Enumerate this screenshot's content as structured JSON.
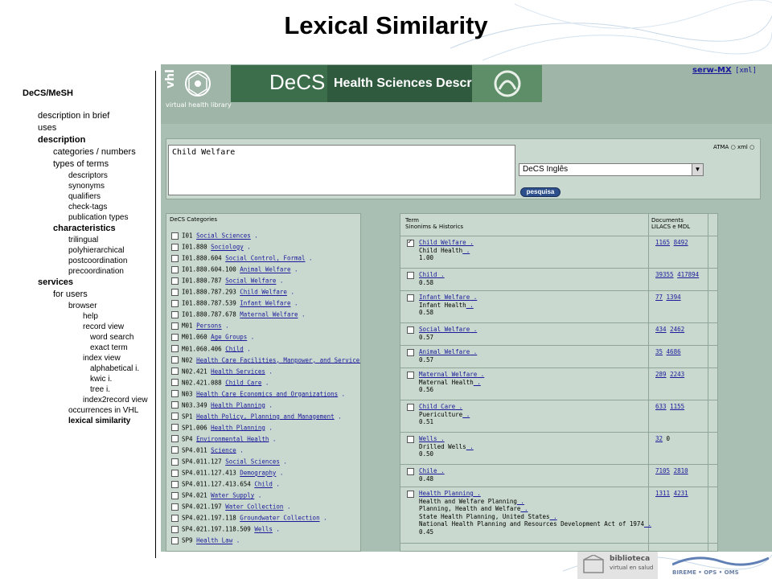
{
  "slide": {
    "title": "Lexical Similarity"
  },
  "outline": [
    {
      "text": "DeCS/MeSH",
      "level": 0,
      "bold": true
    },
    {
      "text": "description in brief",
      "level": 1,
      "bold": false
    },
    {
      "text": "uses",
      "level": 1,
      "bold": false
    },
    {
      "text": "description",
      "level": 1,
      "bold": true
    },
    {
      "text": "categories / numbers",
      "level": 2,
      "bold": false
    },
    {
      "text": "types of terms",
      "level": 2,
      "bold": false
    },
    {
      "text": "descriptors",
      "level": 3,
      "bold": false
    },
    {
      "text": "synonyms",
      "level": 3,
      "bold": false
    },
    {
      "text": "qualifiers",
      "level": 3,
      "bold": false
    },
    {
      "text": "check-tags",
      "level": 3,
      "bold": false
    },
    {
      "text": "publication types",
      "level": 3,
      "bold": false
    },
    {
      "text": "characteristics",
      "level": 2,
      "bold": true
    },
    {
      "text": "trilingual",
      "level": 3,
      "bold": false
    },
    {
      "text": "polyhierarchical",
      "level": 3,
      "bold": false
    },
    {
      "text": "postcoordination",
      "level": 3,
      "bold": false
    },
    {
      "text": "precoordination",
      "level": 3,
      "bold": false
    },
    {
      "text": "services",
      "level": 1,
      "bold": true
    },
    {
      "text": "for users",
      "level": 2,
      "bold": false
    },
    {
      "text": "browser",
      "level": 3,
      "bold": false
    },
    {
      "text": "help",
      "level": 4,
      "bold": false
    },
    {
      "text": "record view",
      "level": 4,
      "bold": false
    },
    {
      "text": "word search",
      "level": 5,
      "bold": false
    },
    {
      "text": "exact term",
      "level": 5,
      "bold": false
    },
    {
      "text": "index view",
      "level": 4,
      "bold": false
    },
    {
      "text": "alphabetical i.",
      "level": 5,
      "bold": false
    },
    {
      "text": "kwic i.",
      "level": 5,
      "bold": false
    },
    {
      "text": "tree i.",
      "level": 5,
      "bold": false
    },
    {
      "text": "index2record view",
      "level": 4,
      "bold": false
    },
    {
      "text": "occurrences in VHL",
      "level": 3,
      "bold": false
    },
    {
      "text": "lexical similarity",
      "level": 3,
      "bold": true
    }
  ],
  "header": {
    "vhl_text": "virtual health library",
    "decs_word": "DeCS",
    "decs_sub": "Health Sciences Descriptors",
    "serw_link": "serw-MX",
    "xml_link": "[xml]"
  },
  "search": {
    "query": "Child Welfare",
    "language": "DeCS Inglês",
    "button": "pesquisa",
    "atma": "ATMA",
    "xml": "xml"
  },
  "categories": {
    "title": "DeCS Categories",
    "rows": [
      {
        "code": "I01",
        "name": "Social Sciences"
      },
      {
        "code": "I01.880",
        "name": "Sociology"
      },
      {
        "code": "I01.880.604",
        "name": "Social Control, Formal"
      },
      {
        "code": "I01.880.604.100",
        "name": "Animal Welfare"
      },
      {
        "code": "I01.880.787",
        "name": "Social Welfare"
      },
      {
        "code": "I01.880.787.293",
        "name": "Child Welfare"
      },
      {
        "code": "I01.880.787.539",
        "name": "Infant Welfare"
      },
      {
        "code": "I01.880.787.678",
        "name": "Maternal Welfare"
      },
      {
        "code": "M01",
        "name": "Persons"
      },
      {
        "code": "M01.060",
        "name": "Age Groups"
      },
      {
        "code": "M01.060.406",
        "name": "Child"
      },
      {
        "code": "N02",
        "name": "Health Care Facilities, Manpower, and Services"
      },
      {
        "code": "N02.421",
        "name": "Health Services"
      },
      {
        "code": "N02.421.088",
        "name": "Child Care"
      },
      {
        "code": "N03",
        "name": "Health Care Economics and Organizations"
      },
      {
        "code": "N03.349",
        "name": "Health Planning"
      },
      {
        "code": "SP1",
        "name": "Health Policy, Planning and Management"
      },
      {
        "code": "SP1.006",
        "name": "Health Planning"
      },
      {
        "code": "SP4",
        "name": "Environmental Health"
      },
      {
        "code": "SP4.011",
        "name": "Science"
      },
      {
        "code": "SP4.011.127",
        "name": "Social Sciences"
      },
      {
        "code": "SP4.011.127.413",
        "name": "Demography"
      },
      {
        "code": "SP4.011.127.413.654",
        "name": "Child"
      },
      {
        "code": "SP4.021",
        "name": "Water Supply"
      },
      {
        "code": "SP4.021.197",
        "name": "Water Collection"
      },
      {
        "code": "SP4.021.197.118",
        "name": "Groundwater Collection"
      },
      {
        "code": "SP4.021.197.118.509",
        "name": "Wells"
      },
      {
        "code": "SP9",
        "name": "Health Law"
      }
    ]
  },
  "results": {
    "head_term": "Term",
    "head_term2": "Sinonims & Historics",
    "head_docs": "Documents",
    "head_docs2": "LILACS e MDL",
    "rows": [
      {
        "term": "Child Welfare",
        "extra": [
          "Child Health"
        ],
        "score": "1.00",
        "lilacs": "1165",
        "mdl": "8492",
        "checked": true,
        "mdl_link": true
      },
      {
        "term": "Child",
        "extra": [],
        "score": "0.58",
        "lilacs": "39355",
        "mdl": "417894",
        "checked": false,
        "mdl_link": true
      },
      {
        "term": "Infant Welfare",
        "extra": [
          "Infant Health"
        ],
        "score": "0.58",
        "lilacs": "77",
        "mdl": "1394",
        "checked": false,
        "mdl_link": true
      },
      {
        "term": "Social Welfare",
        "extra": [],
        "score": "0.57",
        "lilacs": "434",
        "mdl": "2462",
        "checked": false,
        "mdl_link": true
      },
      {
        "term": "Animal Welfare",
        "extra": [],
        "score": "0.57",
        "lilacs": "35",
        "mdl": "4686",
        "checked": false,
        "mdl_link": true
      },
      {
        "term": "Maternal Welfare",
        "extra": [
          "Maternal Health"
        ],
        "score": "0.56",
        "lilacs": "289",
        "mdl": "2243",
        "checked": false,
        "mdl_link": true
      },
      {
        "term": "Child Care",
        "extra": [
          "Puericulture"
        ],
        "score": "0.51",
        "lilacs": "633",
        "mdl": "1155",
        "checked": false,
        "mdl_link": true
      },
      {
        "term": "Wells",
        "extra": [
          "Drilled Wells"
        ],
        "score": "0.50",
        "lilacs": "32",
        "mdl": "0",
        "checked": false,
        "mdl_link": false
      },
      {
        "term": "Chile",
        "extra": [],
        "score": "0.48",
        "lilacs": "7105",
        "mdl": "2810",
        "checked": false,
        "mdl_link": true
      },
      {
        "term": "Health Planning",
        "extra": [
          "Health and Welfare Planning",
          "Planning, Health and Welfare",
          "State Health Planning, United States",
          "National Health Planning and Resources Development Act of 1974"
        ],
        "score": "0.45",
        "lilacs": "1311",
        "mdl": "4231",
        "checked": false,
        "mdl_link": true
      }
    ]
  },
  "footer": {
    "biblio1": "biblioteca",
    "biblio2": "virtual en salud",
    "bireme": "BIREME • OPS • OMS"
  }
}
